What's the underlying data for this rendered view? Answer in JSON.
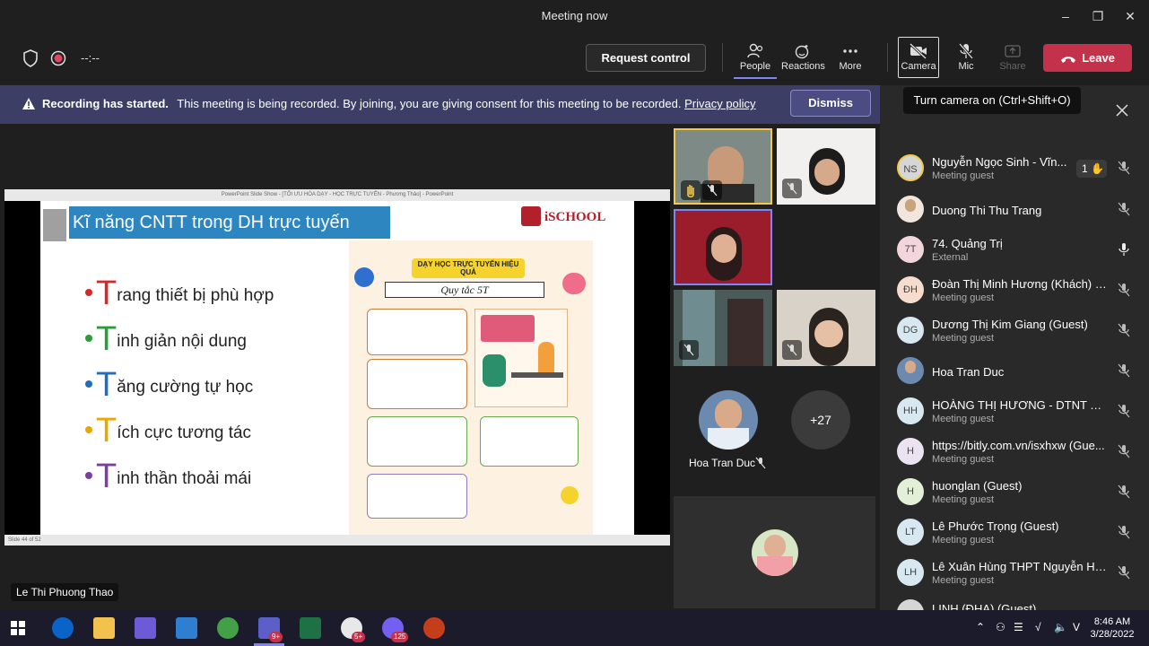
{
  "window": {
    "title": "Meeting now"
  },
  "toolbar": {
    "timer": "--:--",
    "request_control": "Request control",
    "people": "People",
    "reactions": "Reactions",
    "more": "More",
    "camera": "Camera",
    "mic": "Mic",
    "share": "Share",
    "leave": "Leave"
  },
  "banner": {
    "heading": "Recording has started.",
    "message": "This meeting is being recorded. By joining, you are giving consent for this meeting to be recorded.",
    "link": "Privacy policy",
    "dismiss": "Dismiss"
  },
  "tooltip": "Turn camera on (Ctrl+Shift+O)",
  "slide_window": {
    "titlebar": "PowerPoint Slide Show - [TỐI ƯU HÓA DẠY - HỌC TRỰC TUYẾN - Phương Thảo] - PowerPoint",
    "status": "Slide 44 of 52"
  },
  "slide": {
    "title": "Kĩ năng CNTT trong DH trực tuyến",
    "logo": "iSCHOOL",
    "bullets": [
      {
        "big": "T",
        "rest": "rang thiết bị phù hợp",
        "color": "#d62828"
      },
      {
        "big": "T",
        "rest": "inh giản nội dung",
        "color": "#2a9d3a"
      },
      {
        "big": "T",
        "rest": "ăng cường tự học",
        "color": "#1f6fbf"
      },
      {
        "big": "T",
        "rest": "ích cực tương tác",
        "color": "#e9a800"
      },
      {
        "big": "T",
        "rest": "inh thần thoải mái",
        "color": "#7b3fa0"
      }
    ],
    "infographic": {
      "heading": "DẠY HỌC TRỰC TUYẾN HIỆU QUẢ",
      "subheading": "Quy tắc 5T"
    }
  },
  "presenter": "Le Thi Phuong Thao",
  "gallery": {
    "hoa_name": "Hoa Tran Duc",
    "overflow": "+27"
  },
  "participants": [
    {
      "initials": "NS",
      "name": "Nguyễn Ngọc Sinh - Vĩn...",
      "role": "Meeting guest",
      "hand": "1",
      "mic": "off"
    },
    {
      "initials": "",
      "name": "Duong Thi Thu Trang",
      "role": "",
      "mic": "off"
    },
    {
      "initials": "7T",
      "name": "74. Quảng Trị",
      "role": "External",
      "mic": "on"
    },
    {
      "initials": "ĐH",
      "name": "Đoàn Thị Minh Hương (Khách) (...",
      "role": "Meeting guest",
      "mic": "off"
    },
    {
      "initials": "DG",
      "name": "Dương Thị Kim Giang (Guest)",
      "role": "Meeting guest",
      "mic": "off"
    },
    {
      "initials": "",
      "name": "Hoa Tran Duc",
      "role": "",
      "mic": "off"
    },
    {
      "initials": "HH",
      "name": "HOÀNG THỊ HƯƠNG - DTNT TỈ...",
      "role": "Meeting guest",
      "mic": "off"
    },
    {
      "initials": "H",
      "name": "https://bitly.com.vn/isxhxw (Gue...",
      "role": "Meeting guest",
      "mic": "off"
    },
    {
      "initials": "H",
      "name": "huonglan (Guest)",
      "role": "Meeting guest",
      "mic": "off"
    },
    {
      "initials": "LT",
      "name": "Lê Phước Trọng (Guest)",
      "role": "Meeting guest",
      "mic": "off"
    },
    {
      "initials": "LH",
      "name": "Lê Xuân Hùng THPT Nguyễn Hu...",
      "role": "Meeting guest",
      "mic": "off"
    },
    {
      "initials": "",
      "name": "LINH (ĐHA) (Guest)",
      "role": "",
      "mic": "off"
    }
  ],
  "taskbar": {
    "time": "8:46 AM",
    "date": "3/28/2022",
    "badge_teams": "9+",
    "badge_zalo": "5+",
    "badge_viber": "125"
  },
  "colors": {
    "accent": "#7f85f5",
    "leave": "#c4314b",
    "banner": "#3d3e66"
  }
}
